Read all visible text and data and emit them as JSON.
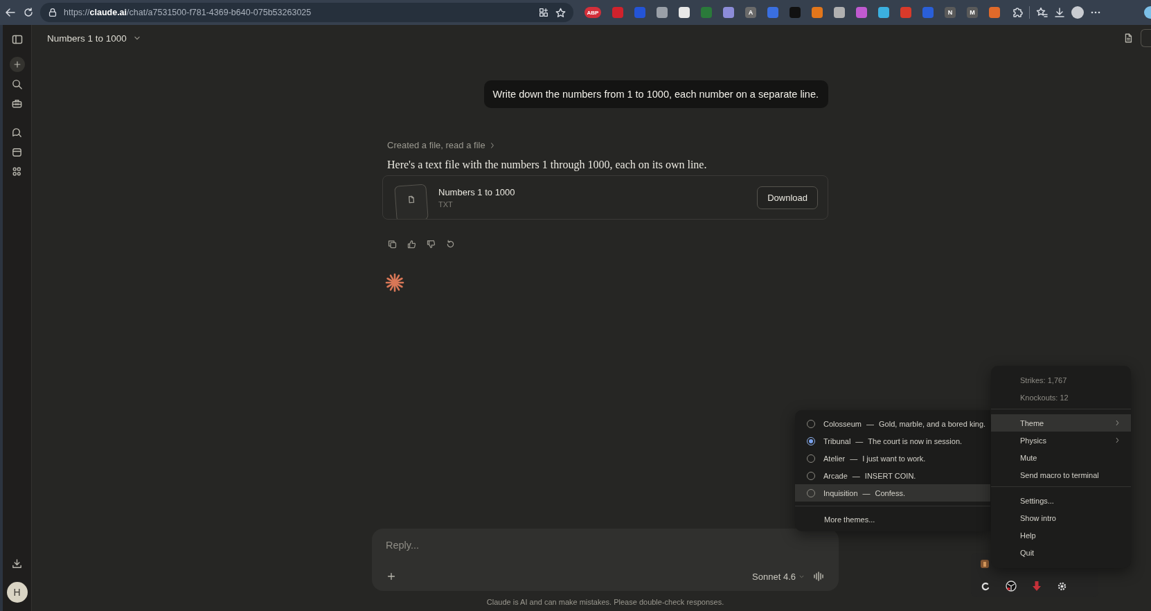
{
  "browser": {
    "url": "https://**claude.ai**/chat/a7531500-f781-4369-b640-075b53263025",
    "extensions": [
      {
        "color": "#d32f3a",
        "letter": "ABP"
      },
      {
        "color": "#d0222c"
      },
      {
        "color": "#2454d6"
      },
      {
        "color": "#9aa0a8"
      },
      {
        "color": "#e8e8e8"
      },
      {
        "color": "#2a7a3a"
      },
      {
        "color": "#8c8cd8"
      },
      {
        "color": "#6a6a6a",
        "letter": "A"
      },
      {
        "color": "#3a6fe0"
      },
      {
        "color": "#111111"
      },
      {
        "color": "#e2761b"
      },
      {
        "color": "#b0b0b0"
      },
      {
        "color": "#c05ad0"
      },
      {
        "color": "#3bb0e0"
      },
      {
        "color": "#d83a2a"
      },
      {
        "color": "#2a5fd8"
      },
      {
        "color": "#5a5a5a",
        "letter": "N"
      },
      {
        "color": "#5a5a5a",
        "letter": "M"
      },
      {
        "color": "#e06a2a"
      }
    ]
  },
  "sidebar": {
    "avatar": "H"
  },
  "header": {
    "title": "Numbers 1 to 1000"
  },
  "chat": {
    "user_message": "Write down the numbers from 1 to 1000, each number on a separate line.",
    "tool_summary": "Created a file, read a file",
    "response": "Here's a text file with the numbers 1 through 1000, each on its own line.",
    "file": {
      "name": "Numbers 1 to 1000",
      "type": "TXT",
      "button": "Download"
    }
  },
  "reply": {
    "placeholder": "Reply...",
    "model": "Sonnet 4.6"
  },
  "disclaimer": "Claude is AI and can make mistakes. Please double-check responses.",
  "theme_menu": {
    "items": [
      {
        "label": "Colosseum",
        "tagline": "Gold, marble, and a bored king.",
        "selected": false,
        "hovered": false
      },
      {
        "label": "Tribunal",
        "tagline": "The court is now in session.",
        "selected": true,
        "hovered": false
      },
      {
        "label": "Atelier",
        "tagline": "I just want to work.",
        "selected": false,
        "hovered": false
      },
      {
        "label": "Arcade",
        "tagline": "INSERT COIN.",
        "selected": false,
        "hovered": false
      },
      {
        "label": "Inquisition",
        "tagline": "Confess.",
        "selected": false,
        "hovered": true
      }
    ],
    "separator": "—",
    "footer": "More themes..."
  },
  "app_menu": {
    "sections": [
      {
        "items": [
          {
            "label": "Strikes: 1,767",
            "kind": "stat",
            "highlighted": false
          },
          {
            "label": "Knockouts: 12",
            "kind": "stat",
            "highlighted": false
          }
        ]
      },
      {
        "items": [
          {
            "label": "Theme",
            "kind": "submenu",
            "highlighted": true
          },
          {
            "label": "Physics",
            "kind": "submenu",
            "highlighted": false
          },
          {
            "label": "Mute",
            "kind": "action",
            "highlighted": false
          },
          {
            "label": "Send macro to terminal",
            "kind": "action",
            "highlighted": false
          }
        ]
      },
      {
        "items": [
          {
            "label": "Settings...",
            "kind": "action",
            "highlighted": false
          },
          {
            "label": "Show intro",
            "kind": "action",
            "highlighted": false
          },
          {
            "label": "Help",
            "kind": "action",
            "highlighted": false
          },
          {
            "label": "Quit",
            "kind": "action",
            "highlighted": false
          }
        ]
      }
    ]
  }
}
